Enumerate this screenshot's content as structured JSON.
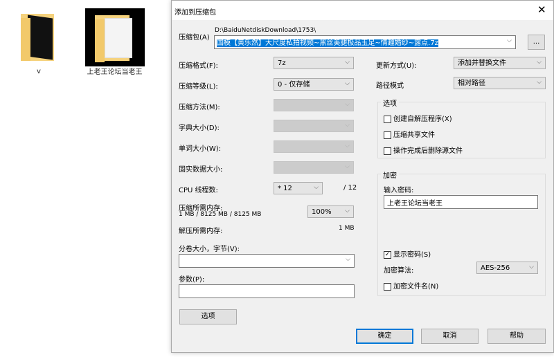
{
  "desktop": {
    "icons": [
      {
        "label": "v"
      },
      {
        "label": "上老王论坛当老王"
      }
    ]
  },
  "dialog": {
    "title": "添加到压缩包",
    "archive_label": "压缩包(A)",
    "archive_dir": "D:\\BaiduNetdiskDownload\\1753\\",
    "archive_name": "国模【黄乐然】大尺度私拍视频~黑丝美腿极品玉足~情趣婚纱~露点.7z",
    "browse_label": "...",
    "format_label": "压缩格式(F):",
    "format_value": "7z",
    "level_label": "压缩等级(L):",
    "level_value": "0 - 仅存储",
    "method_label": "压缩方法(M):",
    "dict_label": "字典大小(D):",
    "word_label": "单词大小(W):",
    "solid_label": "固实数据大小:",
    "cpu_label": "CPU 线程数:",
    "cpu_value": "* 12",
    "cpu_max": "/ 12",
    "mem_comp_label": "压缩所需内存:",
    "mem_comp_value": "1 MB / 8125 MB / 8125 MB",
    "mem_percent": "100%",
    "mem_decomp_label": "解压所需内存:",
    "mem_decomp_value": "1 MB",
    "split_label": "分卷大小，字节(V):",
    "params_label": "参数(P):",
    "options_button": "选项",
    "update_label": "更新方式(U):",
    "update_value": "添加并替换文件",
    "path_label": "路径模式",
    "path_value": "相对路径",
    "options_group": "选项",
    "opt_sfx": "创建自解压程序(X)",
    "opt_shared": "压缩共享文件",
    "opt_delete": "操作完成后删除源文件",
    "encrypt_group": "加密",
    "password_label": "输入密码:",
    "password_value": "上老王论坛当老王",
    "show_password": "显示密码(S)",
    "show_password_checked": true,
    "enc_method_label": "加密算法:",
    "enc_method_value": "AES-256",
    "encrypt_names": "加密文件名(N)",
    "ok": "确定",
    "cancel": "取消",
    "help": "帮助"
  }
}
